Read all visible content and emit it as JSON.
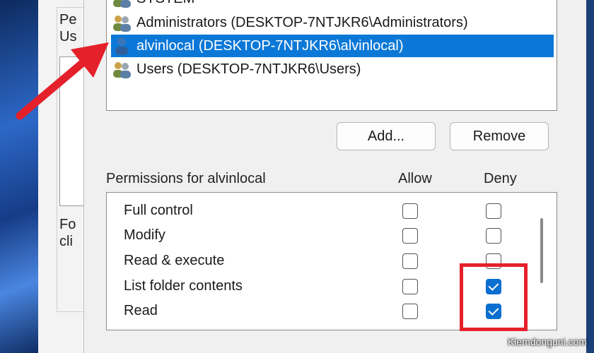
{
  "background_dialog": {
    "label_line1": "Pe",
    "label_line2": "Us",
    "footer_line1": "Fo",
    "footer_line2": "cli"
  },
  "users": {
    "items": [
      {
        "label": "SYSTEM",
        "selected": false,
        "icon": "user-group-icon"
      },
      {
        "label": "Administrators (DESKTOP-7NTJKR6\\Administrators)",
        "selected": false,
        "icon": "user-group-icon"
      },
      {
        "label": "alvinlocal (DESKTOP-7NTJKR6\\alvinlocal)",
        "selected": true,
        "icon": "user-icon"
      },
      {
        "label": "Users (DESKTOP-7NTJKR6\\Users)",
        "selected": false,
        "icon": "user-group-icon"
      }
    ]
  },
  "buttons": {
    "add": "Add...",
    "remove": "Remove"
  },
  "permissions": {
    "header": "Permissions for alvinlocal",
    "allow_label": "Allow",
    "deny_label": "Deny",
    "rows": [
      {
        "name": "Full control",
        "allow": false,
        "deny": false
      },
      {
        "name": "Modify",
        "allow": false,
        "deny": false
      },
      {
        "name": "Read & execute",
        "allow": false,
        "deny": false
      },
      {
        "name": "List folder contents",
        "allow": false,
        "deny": true
      },
      {
        "name": "Read",
        "allow": false,
        "deny": true
      }
    ]
  },
  "colors": {
    "selection": "#0b78d7",
    "checkbox_checked": "#0b6fcf",
    "annotation": "#e4202a"
  },
  "watermark": "Kiemdonguni.com"
}
